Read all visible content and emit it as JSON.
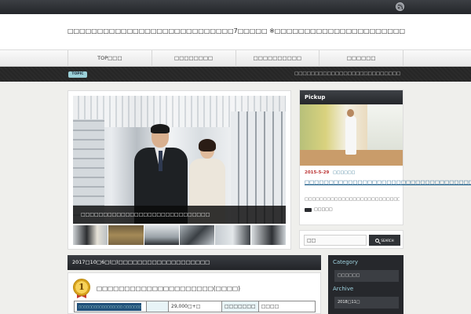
{
  "topbar": {
    "rss_icon": "rss-icon"
  },
  "header": {
    "site_title": "□□□□□□□□□□□□□□□□□□□□□□□□□□□□7□□□□□ ※□□□□□□□□□□□□□□□□□□□□□□"
  },
  "nav": {
    "items": [
      {
        "label": "TOP□□□"
      },
      {
        "label": "□□□□□□□□"
      },
      {
        "label": "□□□□□□□□□□"
      },
      {
        "label": "□□□□□□"
      }
    ]
  },
  "ticker": {
    "badge": "TOPIC",
    "text": "□□□□□□□□□□□□□□□□□□□□□□□□□□"
  },
  "slider": {
    "caption": "□□□□□□□□□□□□□□□□□□□□□□□□□□□□□"
  },
  "pickup": {
    "heading": "Pickup",
    "date": "2015-5-29",
    "category": "□□□□□□",
    "title": "□□□□□□□□□□□□□□□□□□□□□□□□□□□□□□□□□□□",
    "excerpt": "□□□□□□□□□□□□□□□□□□□□□□□□□□□□□□□□□□□□…",
    "more": "□□□□□"
  },
  "search": {
    "value": "□□",
    "button": "SEARCH"
  },
  "post_list": {
    "heading": "2017□10□6□(□)□□□□□□□□□□□□□□□□□□□",
    "first_post": {
      "rank": "1",
      "title": "□□□□□□□□□□□□□□□□□□□□□(□□□□)",
      "thumb_text": "□□□□□□□□□□□□□□□□□ □□□□□□□□□",
      "price": "29,000□+□",
      "label": "□□□□□□□",
      "value": "□□□□"
    }
  },
  "sidebar2": {
    "category_head": "Category",
    "category_item": "□□□□□□",
    "archive_head": "Archive",
    "archive_item": "2018□11□"
  },
  "colors": {
    "accent": "#9bd0d8",
    "dark_bar": "#25272b",
    "link": "#1e5f8a",
    "date": "#b33333"
  }
}
